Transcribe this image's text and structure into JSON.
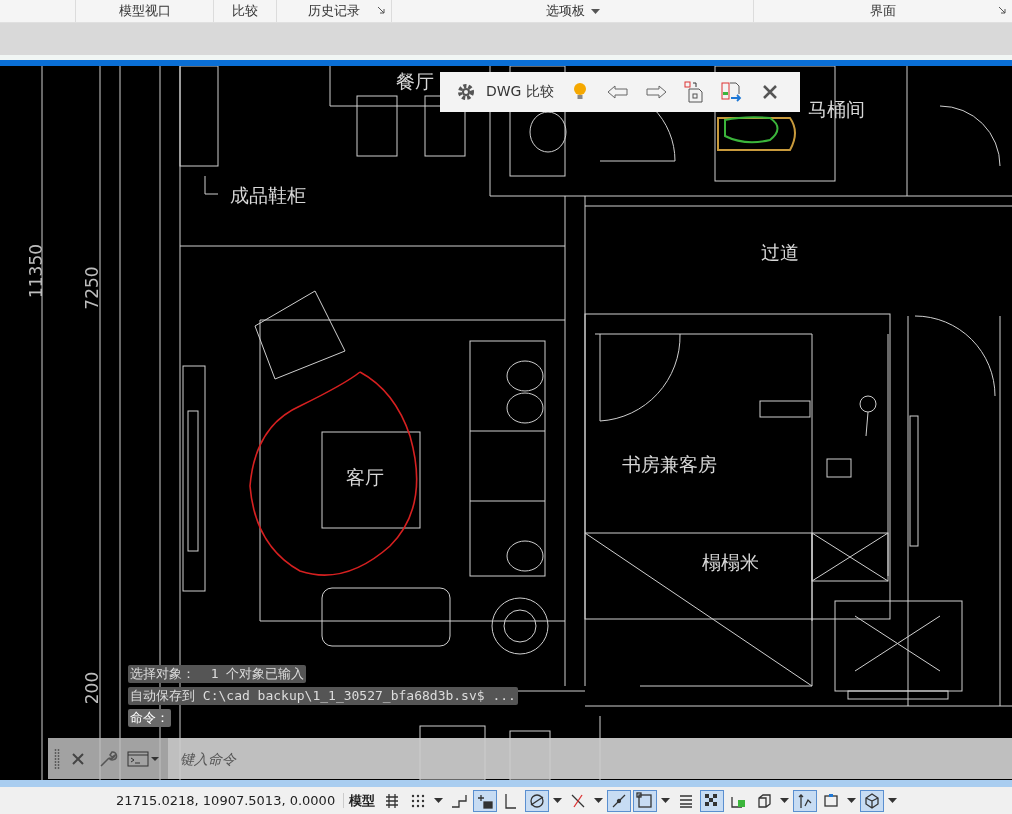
{
  "ribbon": {
    "panels": [
      {
        "label": "模型视口",
        "kind": "plain"
      },
      {
        "label": "比较",
        "kind": "plain"
      },
      {
        "label": "历史记录",
        "kind": "launcher"
      },
      {
        "label": "选项板",
        "kind": "dropdown"
      },
      {
        "label": "界面",
        "kind": "launcher"
      }
    ]
  },
  "compare_toolbar": {
    "title": "DWG 比较"
  },
  "drawing": {
    "labels": [
      {
        "text": "餐厅",
        "kind": "room"
      },
      {
        "text": "马桶间",
        "kind": "room"
      },
      {
        "text": "成品鞋柜",
        "kind": "room"
      },
      {
        "text": "过道",
        "kind": "room"
      },
      {
        "text": "11350",
        "kind": "dimension"
      },
      {
        "text": "7250",
        "kind": "dimension"
      },
      {
        "text": "客厅",
        "kind": "room"
      },
      {
        "text": "书房兼客房",
        "kind": "room"
      },
      {
        "text": "榻榻米",
        "kind": "room"
      },
      {
        "text": "200",
        "kind": "dimension"
      }
    ]
  },
  "command_history": [
    "选择对象：  1 个对象已输入",
    "自动保存到 C:\\cad backup\\1_1_30527_bfa68d3b.sv$ ...",
    "命令："
  ],
  "command_line": {
    "placeholder": "键入命令"
  },
  "status_bar": {
    "coordinates": "21715.0218, 10907.5013, 0.0000",
    "space": "模型",
    "toggles": [
      {
        "on": false,
        "dropdown": false
      },
      {
        "on": false,
        "dropdown": true
      },
      {
        "on": false,
        "dropdown": false
      },
      {
        "on": true,
        "dropdown": false
      },
      {
        "on": false,
        "dropdown": false
      },
      {
        "on": true,
        "dropdown": true
      },
      {
        "on": false,
        "dropdown": true
      },
      {
        "on": true,
        "dropdown": false
      },
      {
        "on": true,
        "dropdown": true
      },
      {
        "on": false,
        "dropdown": false
      },
      {
        "on": true,
        "dropdown": false
      },
      {
        "on": false,
        "dropdown": false
      },
      {
        "on": false,
        "dropdown": true
      },
      {
        "on": true,
        "dropdown": false
      },
      {
        "on": false,
        "dropdown": true
      },
      {
        "on": true,
        "dropdown": true
      }
    ]
  }
}
